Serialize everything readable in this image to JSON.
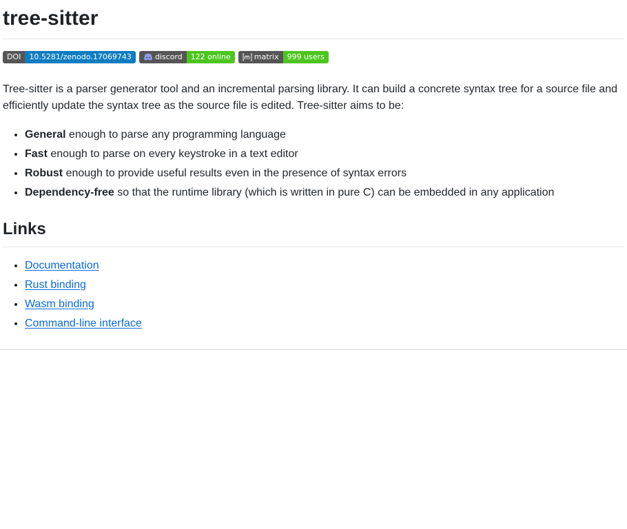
{
  "title": "tree-sitter",
  "badges": [
    {
      "left": "DOI",
      "right": "10.5281/zenodo.17069743",
      "color": "#0f7dc1"
    },
    {
      "left": "discord",
      "right": "122 online",
      "color": "#4cc61e",
      "icon": "discord-icon"
    },
    {
      "left": "matrix",
      "right": "999 users",
      "color": "#4cc61e",
      "icon": "matrix-icon"
    }
  ],
  "intro": "Tree-sitter is a parser generator tool and an incremental parsing library. It can build a concrete syntax tree for a source file and efficiently update the syntax tree as the source file is edited. Tree-sitter aims to be:",
  "features": [
    {
      "term": "General",
      "desc": "enough to parse any programming language"
    },
    {
      "term": "Fast",
      "desc": "enough to parse on every keystroke in a text editor"
    },
    {
      "term": "Robust",
      "desc": "enough to provide useful results even in the presence of syntax errors"
    },
    {
      "term": "Dependency-free",
      "desc": "so that the runtime library (which is written in pure C) can be embedded in any application"
    }
  ],
  "links_heading": "Links",
  "links": [
    {
      "label": "Documentation"
    },
    {
      "label": "Rust binding"
    },
    {
      "label": "Wasm binding"
    },
    {
      "label": "Command-line interface"
    }
  ]
}
